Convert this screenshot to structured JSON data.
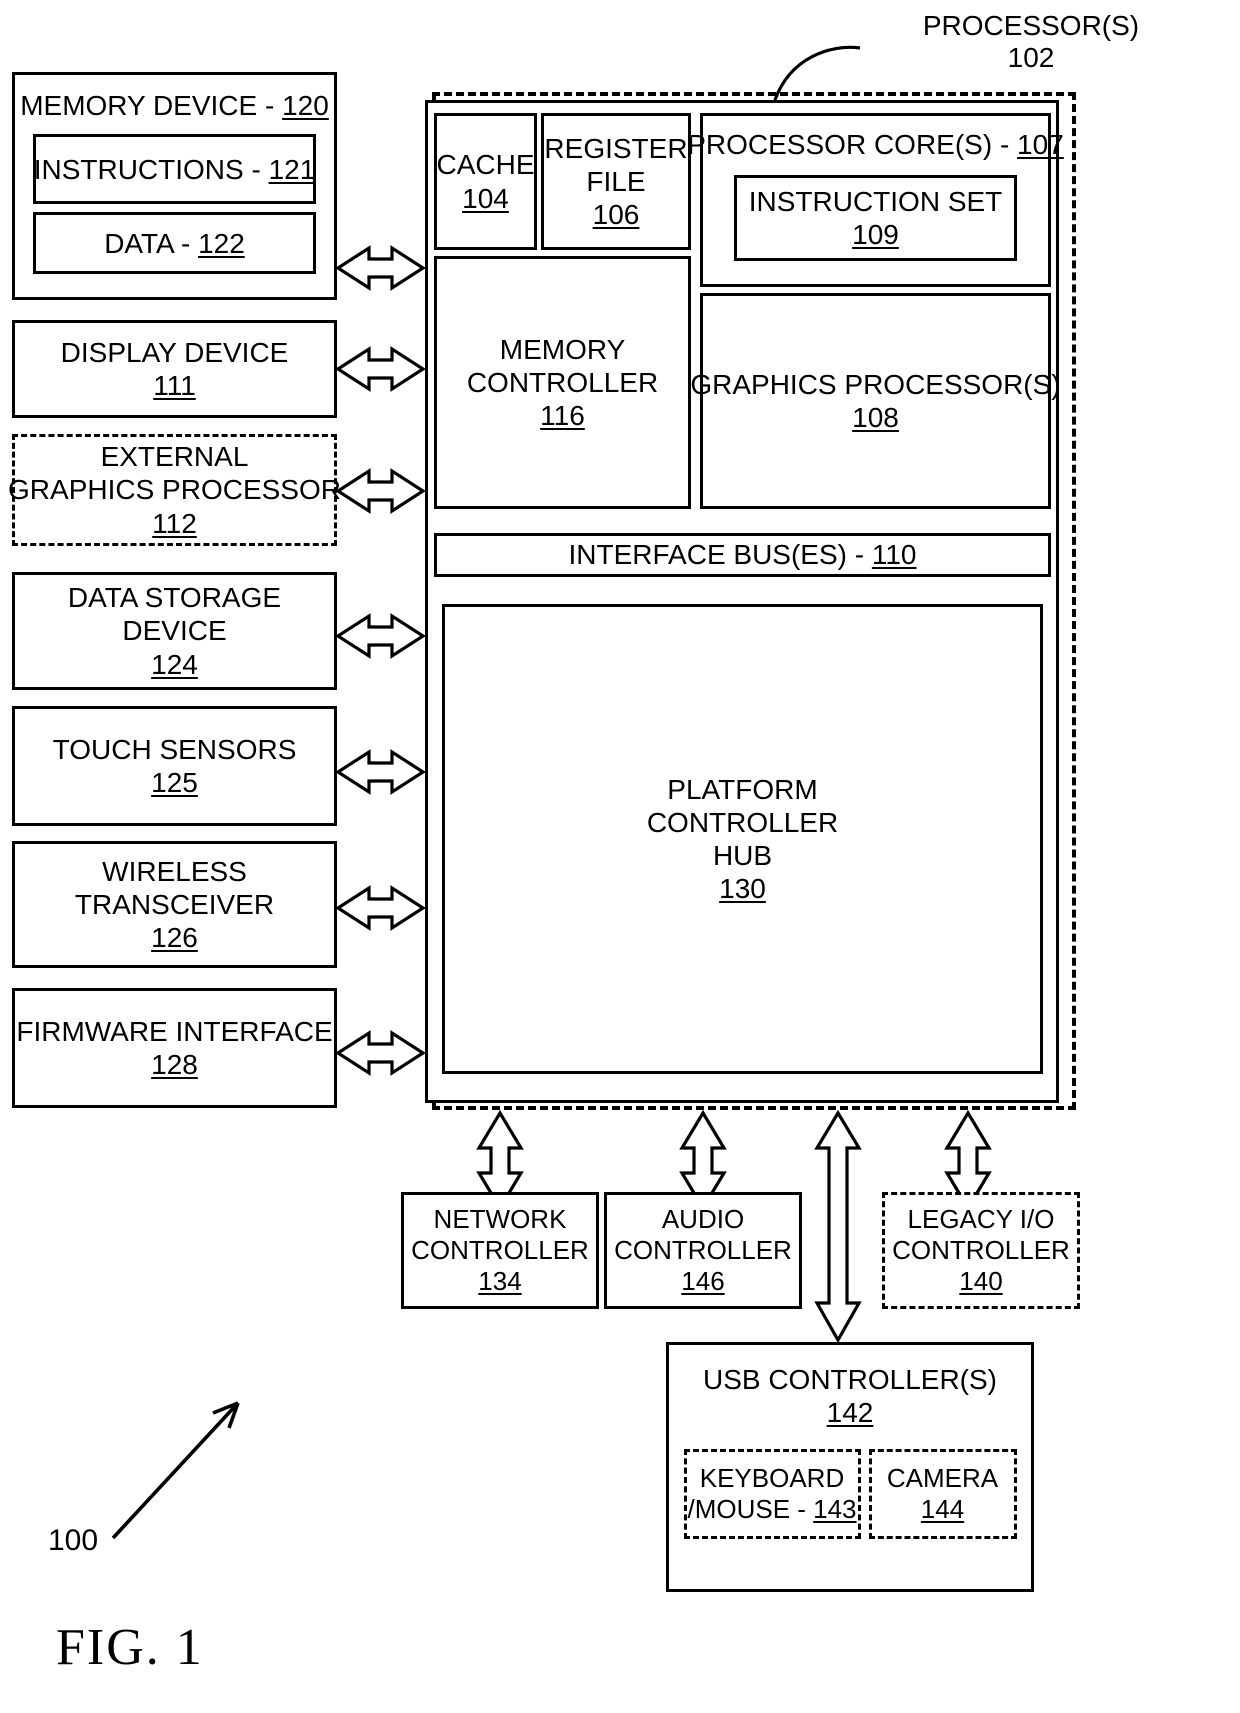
{
  "figure": {
    "label": "FIG. 1",
    "system_ref": "100",
    "processor_callout_title": "PROCESSOR(S)",
    "processor_callout_ref": "102"
  },
  "left_column": [
    {
      "name": "memory-device",
      "title": "MEMORY DEVICE - ",
      "ref": "120",
      "style": "solid",
      "children": [
        {
          "name": "instructions",
          "title": "INSTRUCTIONS - ",
          "ref": "121"
        },
        {
          "name": "data",
          "title": "DATA - ",
          "ref": "122"
        }
      ]
    },
    {
      "name": "display-device",
      "lines": [
        "DISPLAY DEVICE"
      ],
      "ref": "111",
      "style": "solid"
    },
    {
      "name": "external-graphics-processor",
      "lines": [
        "EXTERNAL",
        "GRAPHICS PROCESSOR"
      ],
      "ref": "112",
      "style": "dashed"
    },
    {
      "name": "data-storage-device",
      "lines": [
        "DATA STORAGE",
        "DEVICE"
      ],
      "ref": "124",
      "style": "solid"
    },
    {
      "name": "touch-sensors",
      "lines": [
        "TOUCH SENSORS"
      ],
      "ref": "125",
      "style": "solid"
    },
    {
      "name": "wireless-transceiver",
      "lines": [
        "WIRELESS",
        "TRANSCEIVER"
      ],
      "ref": "126",
      "style": "solid"
    },
    {
      "name": "firmware-interface",
      "lines": [
        "FIRMWARE INTERFACE"
      ],
      "ref": "128",
      "style": "solid"
    }
  ],
  "processor": {
    "cache": {
      "lines": [
        "CACHE"
      ],
      "ref": "104"
    },
    "register_file": {
      "lines": [
        "REGISTER",
        "FILE"
      ],
      "ref": "106"
    },
    "processor_cores": {
      "title": "PROCESSOR CORE(S) - ",
      "ref": "107"
    },
    "instruction_set": {
      "lines": [
        "INSTRUCTION SET"
      ],
      "ref": "109"
    },
    "memory_controller": {
      "lines": [
        "MEMORY",
        "CONTROLLER"
      ],
      "ref": "116"
    },
    "graphics_processor": {
      "lines": [
        "GRAPHICS PROCESSOR(S)"
      ],
      "ref": "108"
    },
    "interface_bus": {
      "title": "INTERFACE BUS(ES) - ",
      "ref": "110"
    },
    "platform_controller_hub": {
      "lines": [
        "PLATFORM",
        "CONTROLLER",
        "HUB"
      ],
      "ref": "130"
    }
  },
  "peripherals": [
    {
      "name": "network-controller",
      "lines": [
        "NETWORK",
        "CONTROLLER"
      ],
      "ref": "134",
      "style": "solid"
    },
    {
      "name": "audio-controller",
      "lines": [
        "AUDIO",
        "CONTROLLER"
      ],
      "ref": "146",
      "style": "solid"
    },
    {
      "name": "legacy-io-controller",
      "lines": [
        "LEGACY I/O",
        "CONTROLLER"
      ],
      "ref": "140",
      "style": "dashed"
    }
  ],
  "usb": {
    "title": "USB CONTROLLER(S)",
    "ref": "142",
    "children": [
      {
        "name": "keyboard-mouse",
        "line1": "KEYBOARD",
        "line2": "/MOUSE - ",
        "ref": "143",
        "style": "dashed"
      },
      {
        "name": "camera",
        "line1": "CAMERA",
        "line2": "",
        "ref": "144",
        "style": "dashed"
      }
    ]
  },
  "colors": {
    "ink": "#000000",
    "paper": "#ffffff"
  }
}
